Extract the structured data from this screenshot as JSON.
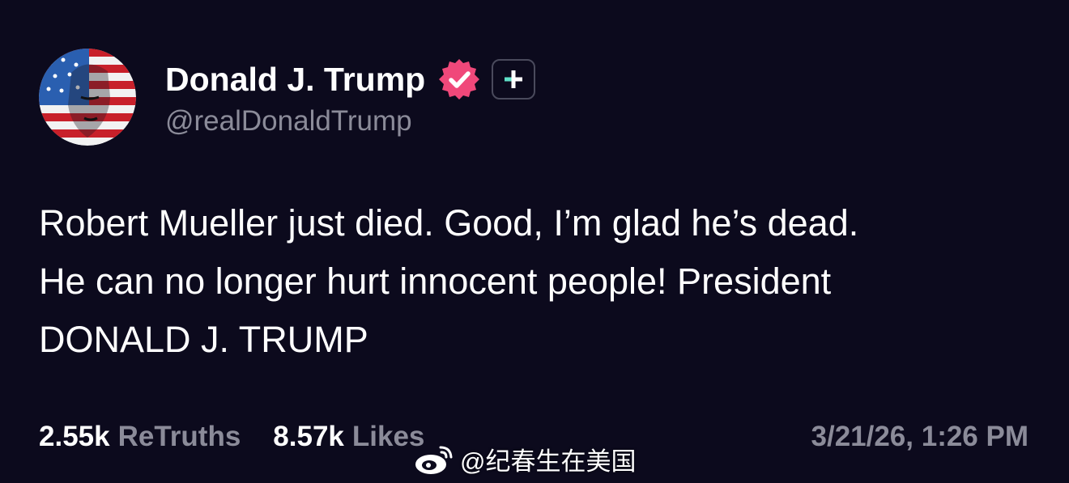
{
  "author": {
    "display_name": "Donald J. Trump",
    "handle": "@realDonaldTrump",
    "verified": true,
    "verified_color": "#f0487a"
  },
  "post": {
    "lines": [
      "Robert Mueller just died. Good, I’m glad he’s dead.",
      "He can no longer hurt innocent people! President",
      "DONALD J. TRUMP"
    ]
  },
  "stats": {
    "retruths_count": "2.55k",
    "retruths_label": "ReTruths",
    "likes_count": "8.57k",
    "likes_label": "Likes",
    "timestamp": "3/21/26, 1:26 PM"
  },
  "watermark": {
    "text": "@纪春生在美国"
  },
  "colors": {
    "background": "#0c0a1d",
    "text": "#ffffff",
    "muted": "#8b8b99",
    "plus_accent": "#5fe0c8"
  }
}
